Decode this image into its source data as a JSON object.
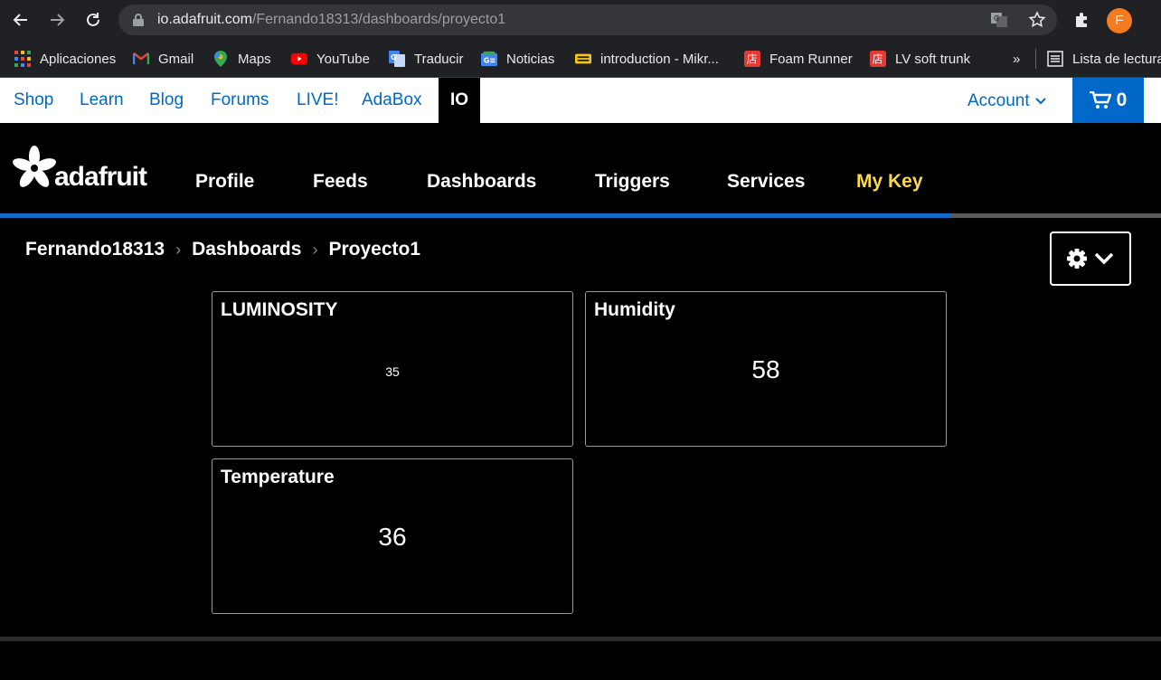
{
  "browser": {
    "url_host": "io.adafruit.com",
    "url_path": "/Fernando18313/dashboards/proyecto1",
    "profile_initial": "F"
  },
  "bookmarks": {
    "items": [
      {
        "label": "Aplicaciones",
        "icon": "apps-grid-icon"
      },
      {
        "label": "Gmail",
        "icon": "gmail-icon"
      },
      {
        "label": "Maps",
        "icon": "maps-icon"
      },
      {
        "label": "YouTube",
        "icon": "youtube-icon"
      },
      {
        "label": "Traducir",
        "icon": "translate-icon"
      },
      {
        "label": "Noticias",
        "icon": "news-icon"
      },
      {
        "label": "introduction - Mikr...",
        "icon": "mikro-icon"
      },
      {
        "label": "Foam Runner",
        "icon": "store-icon"
      },
      {
        "label": "LV soft trunk",
        "icon": "store-icon"
      }
    ],
    "overflow": "»",
    "reading_list": "Lista de lectura"
  },
  "topnav": {
    "links": [
      "Shop",
      "Learn",
      "Blog",
      "Forums",
      "LIVE!",
      "AdaBox"
    ],
    "io": "IO",
    "account": "Account",
    "cart_count": "0"
  },
  "ionav": {
    "logo_text": "adafruit",
    "items": [
      "Profile",
      "Feeds",
      "Dashboards",
      "Triggers",
      "Services"
    ],
    "key": "My Key"
  },
  "breadcrumb": {
    "user": "Fernando18313",
    "section": "Dashboards",
    "page": "Proyecto1",
    "separator": "›"
  },
  "blocks": [
    {
      "title": "LUMINOSITY",
      "value": "35"
    },
    {
      "title": "Humidity",
      "value": "58"
    },
    {
      "title": "Temperature",
      "value": "36"
    }
  ],
  "colors": {
    "brand_blue": "#0068c9",
    "key_yellow": "#fbd94a",
    "background": "#000000"
  }
}
